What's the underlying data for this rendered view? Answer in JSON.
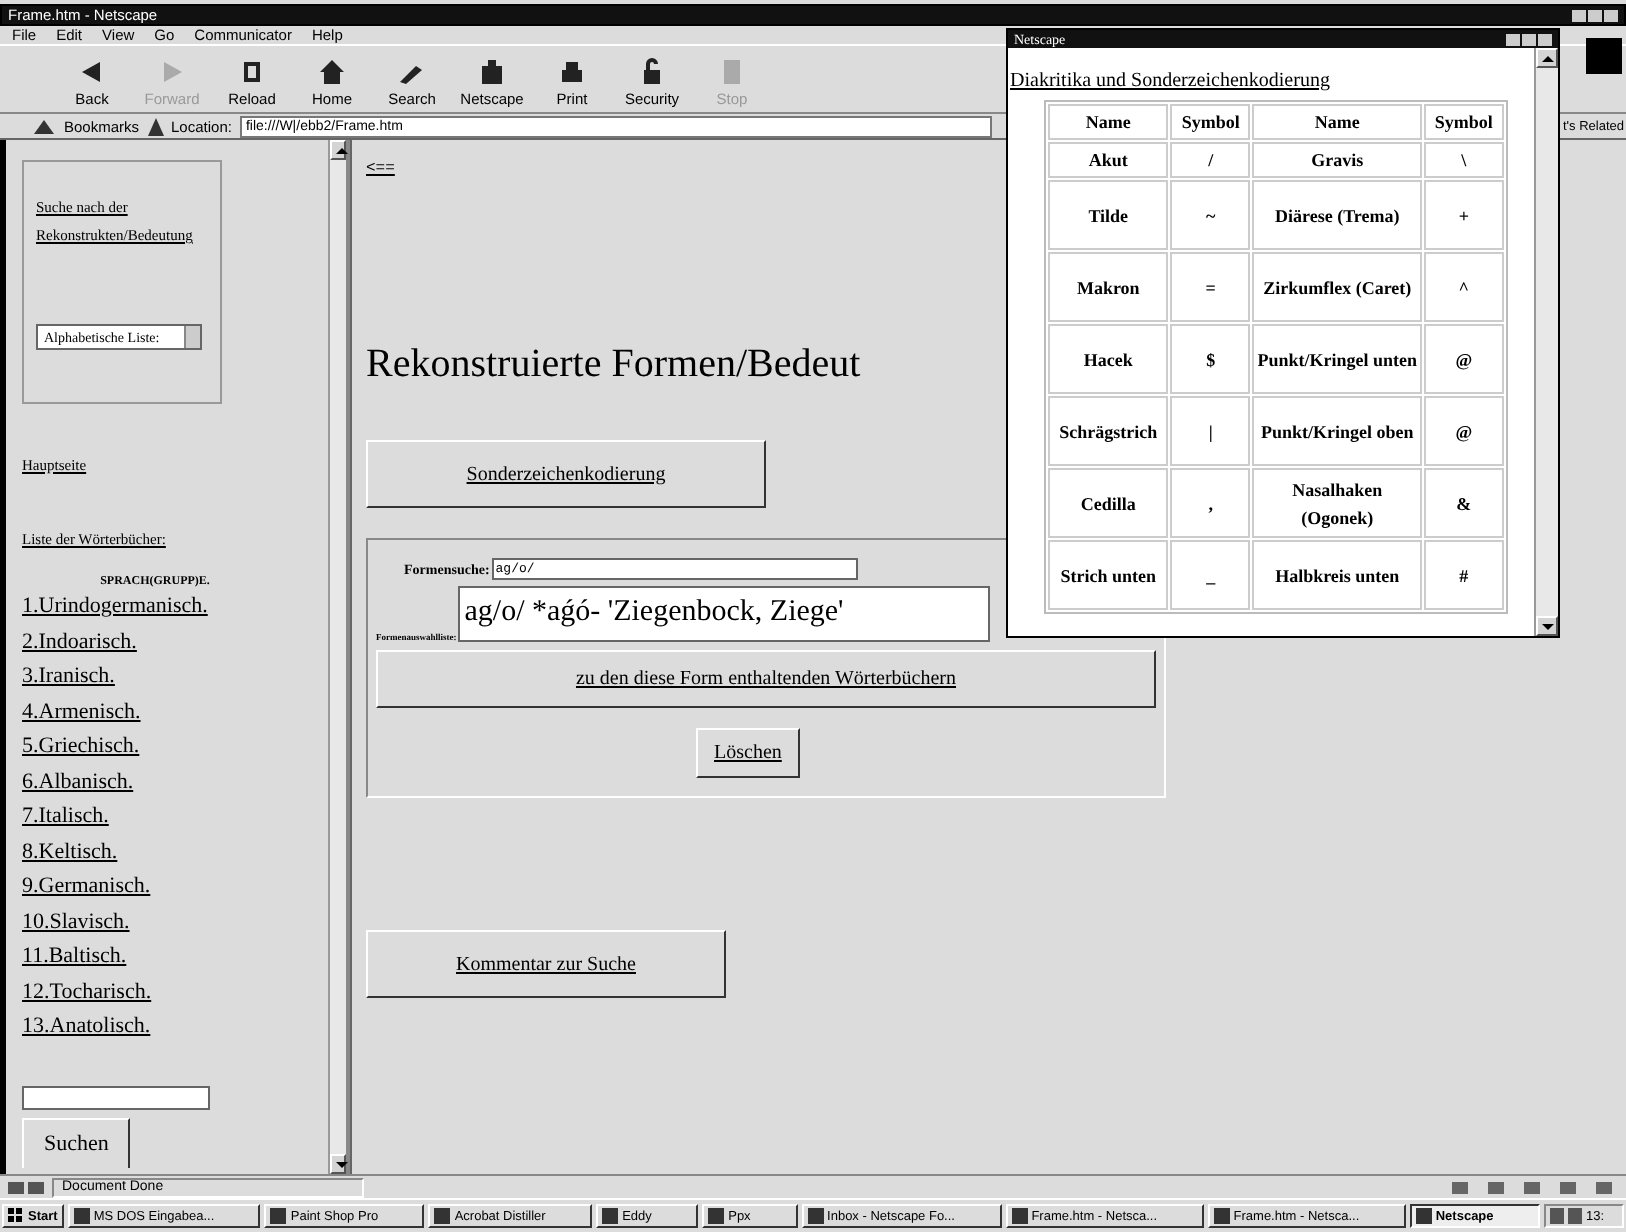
{
  "main_window": {
    "title": "Frame.htm - Netscape"
  },
  "menu": [
    "File",
    "Edit",
    "View",
    "Go",
    "Communicator",
    "Help"
  ],
  "toolbar": [
    {
      "label": "Back",
      "disabled": false
    },
    {
      "label": "Forward",
      "disabled": true
    },
    {
      "label": "Reload",
      "disabled": false
    },
    {
      "label": "Home",
      "disabled": false
    },
    {
      "label": "Search",
      "disabled": false
    },
    {
      "label": "Netscape",
      "disabled": false
    },
    {
      "label": "Print",
      "disabled": false
    },
    {
      "label": "Security",
      "disabled": false
    },
    {
      "label": "Stop",
      "disabled": true
    }
  ],
  "location_bar": {
    "bookmarks": "Bookmarks",
    "label": "Location:",
    "url": "file:///W|/ebb2/Frame.htm",
    "related": "t's Related"
  },
  "left_frame": {
    "search_link": "Suche nach der Rekonstrukten/Bedeutung",
    "list_select": "Alphabetische Liste:",
    "links": [
      "Hauptseite",
      "Liste der Wörterbücher:"
    ],
    "group_heading": "SPRACH(GRUPP)E.",
    "languages": [
      "1.Urindogermanisch.",
      "2.Indoarisch.",
      "3.Iranisch.",
      "4.Armenisch.",
      "5.Griechisch.",
      "6.Albanisch.",
      "7.Italisch.",
      "8.Keltisch.",
      "9.Germanisch.",
      "10.Slavisch.",
      "11.Baltisch.",
      "12.Tocharisch.",
      "13.Anatolisch."
    ],
    "search_button": "Suchen"
  },
  "right_frame": {
    "back_link": "<==",
    "heading": "Rekonstruierte Formen/Bedeut",
    "special_chars_button": "Sonderzeichenkodierung",
    "form": {
      "search_label": "Formensuche:",
      "search_value": "ag/o/",
      "list_label": "Formenauswahlliste:",
      "list_value": "ag/o/ *aǵó- 'Ziegenbock, Ziege'",
      "dictionaries_button": "zu den diese Form enthaltenden Wörterbüchern",
      "clear_button": "Löschen"
    },
    "comment_button": "Kommentar zur Suche"
  },
  "popup": {
    "title": "Netscape",
    "heading": "Diakritika und Sonderzeichenkodierung",
    "columns": [
      "Name",
      "Symbol",
      "Name",
      "Symbol"
    ],
    "rows": [
      [
        "Akut",
        "/",
        "Gravis",
        "\\"
      ],
      [
        "Tilde",
        "~",
        "Diärese (Trema)",
        "+"
      ],
      [
        "Makron",
        "=",
        "Zirkumflex (Caret)",
        "^"
      ],
      [
        "Hacek",
        "$",
        "Punkt/Kringel unten",
        "@"
      ],
      [
        "Schrägstrich",
        "|",
        "Punkt/Kringel oben",
        "@"
      ],
      [
        "Cedilla",
        ",",
        "Nasalhaken (Ogonek)",
        "&"
      ],
      [
        "Strich unten",
        "_",
        "Halbkreis unten",
        "#"
      ]
    ]
  },
  "status_bar": {
    "text": "Document Done"
  },
  "taskbar": {
    "start": "Start",
    "items": [
      {
        "label": "MS DOS Eingabea...",
        "selected": false
      },
      {
        "label": "Paint Shop Pro",
        "selected": false
      },
      {
        "label": "Acrobat Distiller",
        "selected": false
      },
      {
        "label": "Eddy",
        "selected": false
      },
      {
        "label": "Ppx",
        "selected": false
      },
      {
        "label": "Inbox - Netscape Fo...",
        "selected": false
      },
      {
        "label": "Frame.htm - Netsca...",
        "selected": false
      },
      {
        "label": "Frame.htm - Netsca...",
        "selected": false
      },
      {
        "label": "Netscape",
        "selected": true
      }
    ],
    "clock": "13:"
  }
}
